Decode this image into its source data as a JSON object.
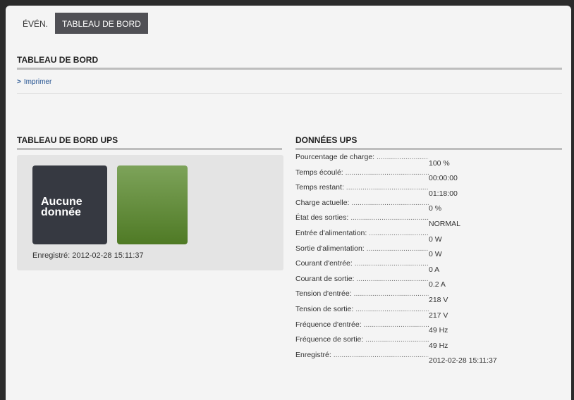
{
  "tabs": [
    {
      "label": "ÉVÉN.",
      "active": false
    },
    {
      "label": "TABLEAU DE BORD",
      "active": true
    }
  ],
  "dashboard": {
    "title": "TABLEAU DE BORD",
    "print_link": "Imprimer"
  },
  "ups_dashboard": {
    "title": "TABLEAU DE BORD UPS",
    "tile_text": "Aucune donnée",
    "recorded": "Enregistré: 2012-02-28 15:11:37"
  },
  "ups_data": {
    "title": "DONNÉES UPS",
    "rows": [
      {
        "label": "Pourcentage de charge:",
        "value": "100 %"
      },
      {
        "label": "Temps écoulé:",
        "value": "00:00:00"
      },
      {
        "label": "Temps restant:",
        "value": "01:18:00"
      },
      {
        "label": "Charge actuelle:",
        "value": "0 %"
      },
      {
        "label": "État des sorties:",
        "value": "NORMAL"
      },
      {
        "label": "Entrée d'alimentation:",
        "value": "0 W"
      },
      {
        "label": "Sortie d'alimentation:",
        "value": "0 W"
      },
      {
        "label": "Courant d'entrée:",
        "value": "0 A"
      },
      {
        "label": "Courant de sortie:",
        "value": "0.2 A"
      },
      {
        "label": "Tension d'entrée:",
        "value": "218 V"
      },
      {
        "label": "Tension de sortie:",
        "value": "217 V"
      },
      {
        "label": "Fréquence d'entrée:",
        "value": "49 Hz"
      },
      {
        "label": "Fréquence de sortie:",
        "value": "49 Hz"
      },
      {
        "label": "Enregistré:",
        "value": "2012-02-28 15:11:37"
      }
    ]
  },
  "colors": {
    "active_tab": "#505055",
    "tile_dark": "#363941",
    "tile_green_top": "#7da35a",
    "tile_green_bottom": "#4f7a25",
    "link": "#1f4f8f"
  }
}
